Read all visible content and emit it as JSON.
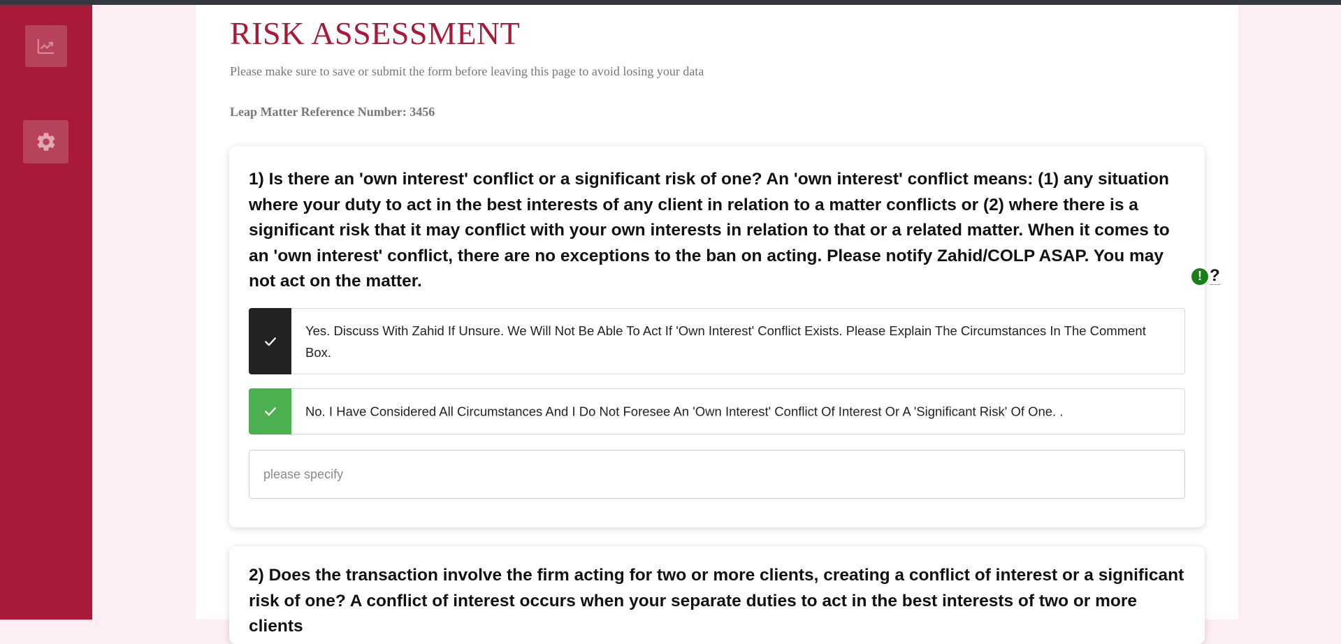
{
  "sidebar": {
    "items": [
      {
        "icon": "trending-up-icon"
      },
      {
        "icon": "gear-icon"
      }
    ]
  },
  "page": {
    "title": "RISK ASSESSMENT",
    "notice": "Please make sure to save or submit the form before leaving this page to avoid losing your data",
    "reference": "Leap Matter Reference Number: 3456"
  },
  "questions": [
    {
      "text": "1) Is there an 'own interest' conflict or a significant risk of one? An 'own interest' conflict means: (1) any situation where your duty to act in the best interests of any client in relation to a matter conflicts or (2) where there is a significant risk that it may conflict with your own interests in relation to that or a related matter. When it comes to an 'own interest' conflict, there are no exceptions to the ban on acting. Please notify Zahid/COLP ASAP. You may not act on the matter.",
      "help_mark": "?",
      "options": [
        {
          "label": "Yes. Discuss With Zahid If Unsure. We Will Not Be Able To Act If 'Own Interest' Conflict Exists. Please Explain The Circumstances In The Comment Box.",
          "check_color": "#222222"
        },
        {
          "label": "No. I Have Considered All Circumstances And I Do Not Foresee An 'Own Interest' Conflict Of Interest Or A 'Significant Risk' Of One. .",
          "check_color": "#4caf50"
        }
      ],
      "comment": {
        "value": "",
        "placeholder": "please specify"
      }
    },
    {
      "text": "2) Does the transaction involve the firm acting for two or more clients, creating a conflict of interest or a significant risk of one? A conflict of interest occurs when your separate duties to act in the best interests of two or more clients"
    }
  ],
  "colors": {
    "brand": "#a81a37",
    "page_bg": "#fdeef3",
    "alert_green": "#1a7f1a",
    "check_green": "#4caf50",
    "check_dark": "#222222"
  }
}
